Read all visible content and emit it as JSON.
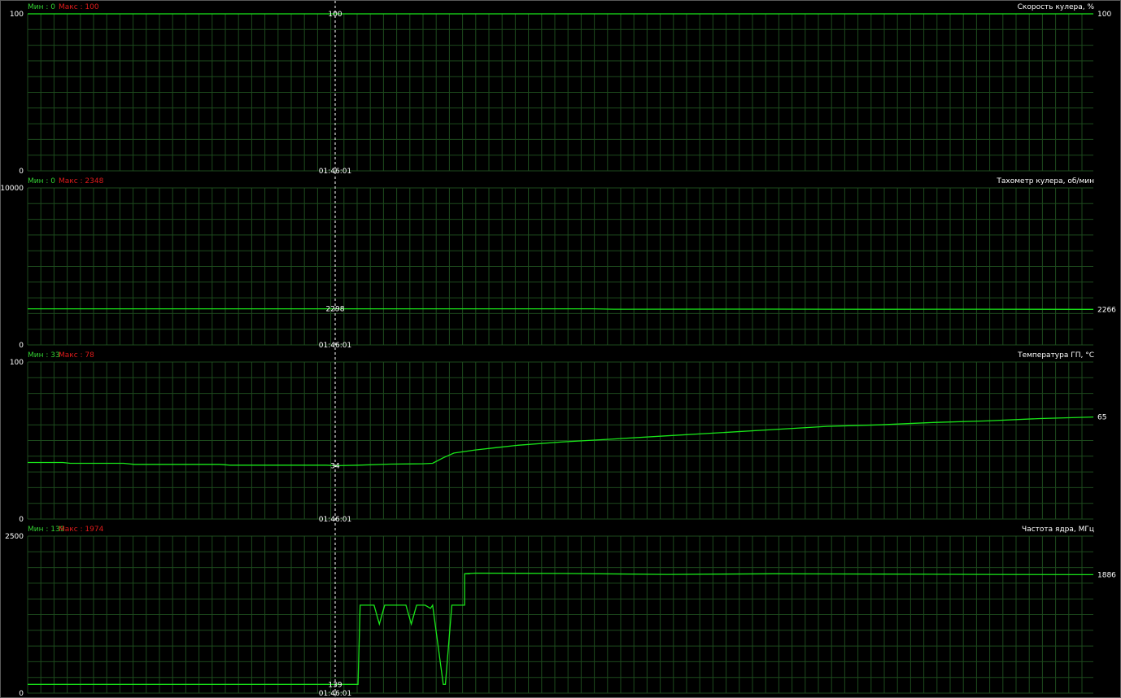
{
  "colors": {
    "background": "#000000",
    "grid": "#1d4a1d",
    "axis_text": "#ffffff",
    "min_text": "#32d232",
    "max_text": "#e01b1b",
    "line": "#19e619",
    "cursor": "#ffffff"
  },
  "cursor": {
    "time": "01:46:01"
  },
  "chart_data": [
    {
      "type": "line",
      "title": "Скорость кулера, %",
      "min_label": "Мин : 0",
      "max_label": "Макс : 100",
      "ylim": [
        0,
        100
      ],
      "y_top_label": "100",
      "y_bottom_label": "0",
      "cursor_value": "100",
      "current_value": "100",
      "series": [
        {
          "x": [
            0,
            1
          ],
          "y": [
            100,
            100
          ]
        }
      ]
    },
    {
      "type": "line",
      "title": "Тахометр кулера, об/мин",
      "min_label": "Мин : 0",
      "max_label": "Макс : 2348",
      "ylim": [
        0,
        10000
      ],
      "y_top_label": "10000",
      "y_bottom_label": "0",
      "cursor_value": "2298",
      "current_value": "2266",
      "series": [
        {
          "x": [
            0,
            0.28,
            0.29,
            0.53,
            0.55,
            0.7,
            0.8,
            0.9,
            1
          ],
          "y": [
            2298,
            2298,
            2298,
            2298,
            2275,
            2282,
            2270,
            2275,
            2266
          ]
        }
      ]
    },
    {
      "type": "line",
      "title": "Температура ГП, °C",
      "min_label": "Мин : 33",
      "max_label": "Макс : 78",
      "ylim": [
        0,
        100
      ],
      "y_top_label": "100",
      "y_bottom_label": "0",
      "cursor_value": "34",
      "current_value": "65",
      "series": [
        {
          "x": [
            0,
            0.033,
            0.04,
            0.09,
            0.1,
            0.18,
            0.19,
            0.28,
            0.29,
            0.31,
            0.34,
            0.37,
            0.38,
            0.39,
            0.4,
            0.42,
            0.44,
            0.46,
            0.5,
            0.55,
            0.6,
            0.65,
            0.7,
            0.75,
            0.8,
            0.85,
            0.9,
            0.95,
            1
          ],
          "y": [
            36,
            36,
            35.5,
            35.5,
            34.8,
            34.8,
            34.3,
            34.3,
            34,
            34.3,
            35,
            35.2,
            35.5,
            39,
            42,
            44,
            45.5,
            47,
            49,
            51,
            53,
            55,
            57,
            59,
            60,
            61.5,
            62.5,
            64,
            65
          ]
        }
      ]
    },
    {
      "type": "line",
      "title": "Частота ядра, МГц",
      "min_label": "Мин : 139",
      "max_label": "Макс : 1974",
      "ylim": [
        0,
        2500
      ],
      "y_top_label": "2500",
      "y_bottom_label": "0",
      "cursor_value": "139",
      "current_value": "1886",
      "series": [
        {
          "x": [
            0,
            0.31,
            0.312,
            0.325,
            0.33,
            0.335,
            0.34,
            0.355,
            0.36,
            0.365,
            0.37,
            0.373,
            0.378,
            0.38,
            0.39,
            0.392,
            0.398,
            0.41,
            0.41,
            0.415,
            0.41,
            0.42,
            0.5,
            0.6,
            0.7,
            0.8,
            0.9,
            1
          ],
          "y": [
            139,
            139,
            1400,
            1400,
            1100,
            1400,
            1400,
            1400,
            1100,
            1400,
            1400,
            1400,
            1350,
            1400,
            139,
            139,
            1400,
            1400,
            1900,
            1900,
            1900,
            1910,
            1905,
            1890,
            1900,
            1895,
            1890,
            1886
          ]
        }
      ]
    }
  ]
}
